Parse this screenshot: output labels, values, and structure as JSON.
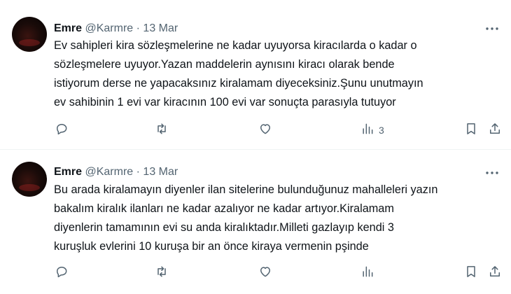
{
  "tweets": [
    {
      "author": "Emre",
      "handle": "@Karmre",
      "separator": "·",
      "date": "13 Mar",
      "text": "Ev sahipleri kira sözleşmelerine ne kadar uyuyorsa kiracılarda o kadar o\nsözleşmelere uyuyor.Yazan maddelerin aynısını kiracı olarak bende\nistiyorum derse ne yapacaksınız kiralamam diyeceksiniz.Şunu unutmayın\nev sahibinin 1 evi var kiracının 100 evi var sonuçta parasıyla tutuyor",
      "views": "3"
    },
    {
      "author": "Emre",
      "handle": "@Karmre",
      "separator": "·",
      "date": "13 Mar",
      "text": "Bu arada kiralamayın diyenler ilan sitelerine bulunduğunuz mahalleleri yazın\nbakalım kiralık ilanları ne kadar azalıyor ne kadar artıyor.Kiralamam\ndiyenlerin tamamının evi su anda kiralıktadır.Milleti gazlayıp kendi 3\nkuruşluk evlerini 10 kuruşa bir an önce kiraya vermenin pşinde",
      "views": ""
    }
  ],
  "icons": {
    "more": "more-horizontal-icon",
    "reply": "reply-icon",
    "retweet": "retweet-icon",
    "like": "like-icon",
    "views": "views-icon",
    "bookmark": "bookmark-icon",
    "share": "share-icon"
  },
  "colors": {
    "text": "#0f1419",
    "secondary": "#536471",
    "divider": "#eff3f4"
  }
}
